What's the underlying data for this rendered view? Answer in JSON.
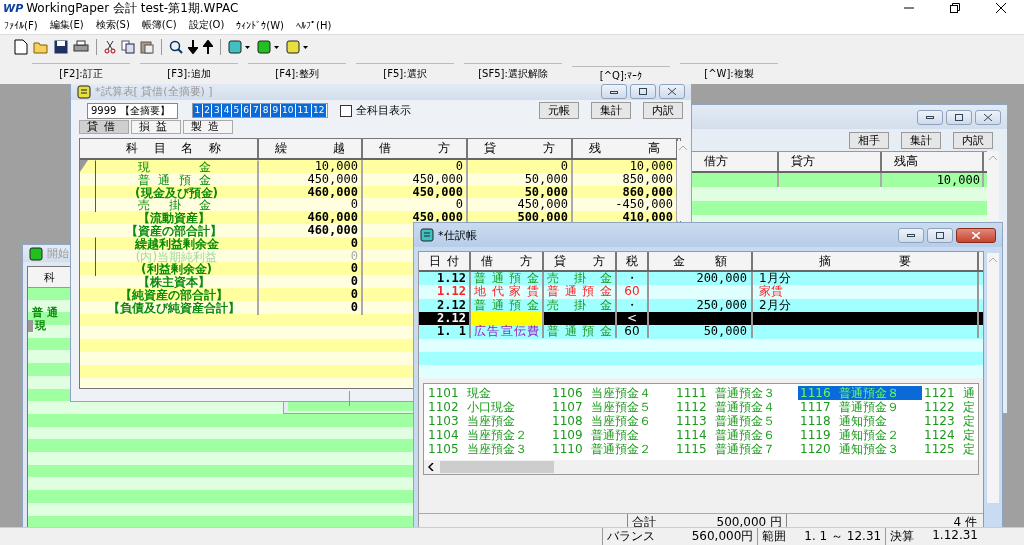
{
  "app": {
    "logo": "WP",
    "title": "WorkingPaper 会計 test-第1期.WPAC"
  },
  "menu": [
    "ﾌｧｲﾙ(F)",
    "編集(E)",
    "検索(S)",
    "帳簿(C)",
    "設定(O)",
    "ｳｨﾝﾄﾞｳ(W)",
    "ﾍﾙﾌﾟ(H)"
  ],
  "function_keys": [
    "[F2]:訂正",
    "[F3]:追加",
    "[F4]:整列",
    "[F5]:選択",
    "[SF5]:選択解除",
    "[^Q]:ﾏｰｸ",
    "[^W]:複製"
  ],
  "opening": {
    "title": "開始",
    "column": "科",
    "rows": [
      {
        "name": "",
        "selected": false
      },
      {
        "name": "普通",
        "selected": false
      },
      {
        "name": "現",
        "selected": true
      }
    ]
  },
  "ledger": {
    "buttons": [
      "相手",
      "集計",
      "内訳"
    ],
    "columns": [
      "借方",
      "貸方",
      "残高"
    ],
    "rows": [
      {
        "balance": "10,000"
      }
    ]
  },
  "trial_balance": {
    "title": "*試算表[ 貸借(全摘要) ]",
    "filter": "9999 【全摘要】",
    "months": [
      {
        "label": "1",
        "selected": true
      },
      {
        "label": "2",
        "selected": true
      },
      {
        "label": "3",
        "selected": true
      },
      {
        "label": "4",
        "selected": true
      },
      {
        "label": "5",
        "selected": true
      },
      {
        "label": "6",
        "selected": true
      },
      {
        "label": "7",
        "selected": true
      },
      {
        "label": "8",
        "selected": true
      },
      {
        "label": "9",
        "selected": true
      },
      {
        "label": "10",
        "selected": true
      },
      {
        "label": "11",
        "selected": true
      },
      {
        "label": "12",
        "selected": true
      }
    ],
    "all_accounts": {
      "label": "全科目表示",
      "checked": false
    },
    "buttons": [
      "元帳",
      "集計",
      "内訳"
    ],
    "tabs": [
      {
        "label": "貸借",
        "selected": true
      },
      {
        "label": "損益",
        "selected": false
      },
      {
        "label": "製造",
        "selected": false
      }
    ],
    "columns": [
      "科目名称",
      "繰越",
      "借方",
      "貸方",
      "残高"
    ],
    "rows": [
      {
        "name": "現金",
        "kind": "account",
        "in_group": true,
        "selected": true,
        "carry": "10,000",
        "debit": "0",
        "credit": "0",
        "balance": "10,000"
      },
      {
        "name": "普通預金",
        "kind": "account",
        "in_group": true,
        "selected": false,
        "carry": "450,000",
        "debit": "450,000",
        "credit": "50,000",
        "balance": "850,000"
      },
      {
        "name": "(現金及び預金)",
        "kind": "total",
        "in_group": true,
        "selected": false,
        "carry": "460,000",
        "debit": "450,000",
        "credit": "50,000",
        "balance": "860,000"
      },
      {
        "name": "売掛金",
        "kind": "account",
        "in_group": true,
        "selected": false,
        "carry": "0",
        "debit": "0",
        "credit": "450,000",
        "balance": "-450,000"
      },
      {
        "name": "【流動資産】",
        "kind": "total",
        "in_group": false,
        "selected": false,
        "carry": "460,000",
        "debit": "450,000",
        "credit": "500,000",
        "balance": "410,000"
      },
      {
        "name": "【資産の部合計】",
        "kind": "total",
        "in_group": false,
        "selected": false,
        "carry": "460,000"
      },
      {
        "name": "繰越利益剰余金",
        "kind": "total",
        "in_group": true,
        "selected": false,
        "carry": "0"
      },
      {
        "name": "(内)当期純利益",
        "kind": "memo",
        "in_group": true,
        "selected": false,
        "carry": "0"
      },
      {
        "name": "(利益剰余金)",
        "kind": "total",
        "in_group": true,
        "selected": false,
        "carry": "0"
      },
      {
        "name": "【株主資本】",
        "kind": "total",
        "in_group": false,
        "selected": false,
        "carry": "0"
      },
      {
        "name": "【純資産の部合計】",
        "kind": "total",
        "in_group": false,
        "selected": false,
        "carry": "0"
      },
      {
        "name": "【負債及び純資産合計】",
        "kind": "total",
        "in_group": false,
        "selected": false,
        "carry": "0"
      }
    ]
  },
  "journal": {
    "title": "*仕訳帳",
    "columns": [
      "日付",
      "借方",
      "貸方",
      "税",
      "金額",
      "摘要"
    ],
    "rows": [
      {
        "date": "1.12",
        "flagged": false,
        "debit": {
          "text": "普通預金",
          "kind": "asset"
        },
        "credit": {
          "text": "売掛金",
          "kind": "asset"
        },
        "tax": "・",
        "amount": "200,000",
        "memo": "1月分",
        "selected": false
      },
      {
        "date": "1.12",
        "flagged": true,
        "debit": {
          "text": "地代家賃",
          "kind": "expense"
        },
        "credit": {
          "text": "普通預金",
          "kind": "asset"
        },
        "tax": "60",
        "memo": "家賃",
        "selected": false
      },
      {
        "date": "2.12",
        "flagged": false,
        "debit": {
          "text": "普通預金",
          "kind": "asset"
        },
        "credit": {
          "text": "売掛金",
          "kind": "asset"
        },
        "tax": "・",
        "amount": "250,000",
        "memo": "2月分",
        "selected": false
      },
      {
        "date": "2.12",
        "flagged": false,
        "tax": "<",
        "selected": true
      },
      {
        "date": "1. 1",
        "flagged": false,
        "debit": {
          "text": "広告宣伝費",
          "kind": "expense"
        },
        "credit": {
          "text": "普通預金",
          "kind": "asset"
        },
        "tax": "60",
        "amount": "50,000",
        "selected": false
      }
    ],
    "accounts": [
      {
        "code": "1101",
        "name": "現金",
        "selected": false
      },
      {
        "code": "1102",
        "name": "小口現金",
        "selected": false
      },
      {
        "code": "1103",
        "name": "当座預金",
        "selected": false
      },
      {
        "code": "1104",
        "name": "当座預金２",
        "selected": false
      },
      {
        "code": "1105",
        "name": "当座預金３",
        "selected": false
      },
      {
        "code": "1106",
        "name": "当座預金４",
        "selected": false
      },
      {
        "code": "1107",
        "name": "当座預金５",
        "selected": false
      },
      {
        "code": "1108",
        "name": "当座預金６",
        "selected": false
      },
      {
        "code": "1109",
        "name": "普通預金",
        "selected": false
      },
      {
        "code": "1110",
        "name": "普通預金２",
        "selected": false
      },
      {
        "code": "1111",
        "name": "普通預金３",
        "selected": false
      },
      {
        "code": "1112",
        "name": "普通預金４",
        "selected": false
      },
      {
        "code": "1113",
        "name": "普通預金５",
        "selected": false
      },
      {
        "code": "1114",
        "name": "普通預金６",
        "selected": false
      },
      {
        "code": "1115",
        "name": "普通預金７",
        "selected": false
      },
      {
        "code": "1116",
        "name": "普通預金８",
        "selected": true
      },
      {
        "code": "1117",
        "name": "普通預金９",
        "selected": false
      },
      {
        "code": "1118",
        "name": "通知預金",
        "selected": false
      },
      {
        "code": "1119",
        "name": "通知預金２",
        "selected": false
      },
      {
        "code": "1120",
        "name": "通知預金３",
        "selected": false
      },
      {
        "code": "1121",
        "name": "通",
        "selected": false
      },
      {
        "code": "1122",
        "name": "定",
        "selected": false
      },
      {
        "code": "1123",
        "name": "定",
        "selected": false
      },
      {
        "code": "1124",
        "name": "定",
        "selected": false
      },
      {
        "code": "1125",
        "name": "定",
        "selected": false
      }
    ],
    "total_label": "合計",
    "total": "500,000 円",
    "count": "4 件"
  },
  "status_bar": {
    "balance_label": "バランス",
    "balance": "560,000円",
    "range_label": "範囲",
    "range": "1. 1 ～ 12.31",
    "closing_label": "決算",
    "closing": "1.12.31"
  }
}
